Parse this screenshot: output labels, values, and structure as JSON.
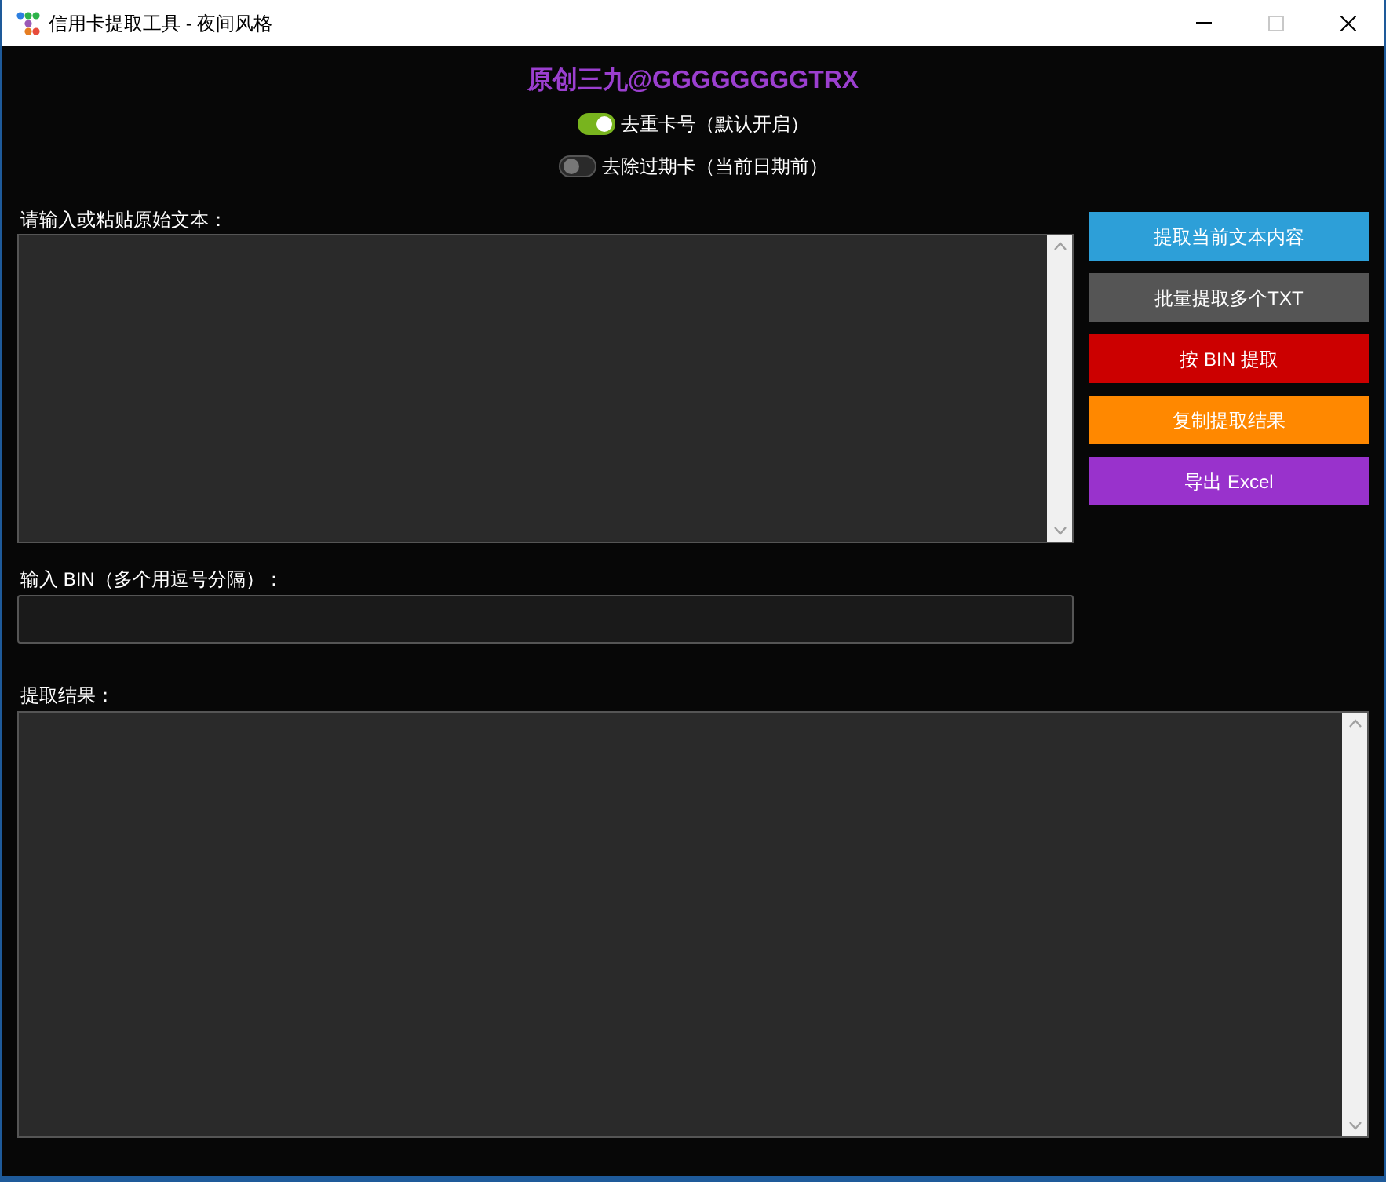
{
  "window": {
    "title": "信用卡提取工具 - 夜间风格"
  },
  "header": "原创三九@GGGGGGGGTRX",
  "toggles": [
    {
      "label": "去重卡号（默认开启）",
      "on": true
    },
    {
      "label": "去除过期卡（当前日期前）",
      "on": false
    }
  ],
  "source_label": "请输入或粘贴原始文本：",
  "bin_label": "输入 BIN（多个用逗号分隔）：",
  "result_label": "提取结果：",
  "buttons": [
    {
      "label": "提取当前文本内容",
      "color": "#2d9fd8"
    },
    {
      "label": "批量提取多个TXT",
      "color": "#555555"
    },
    {
      "label": "按 BIN 提取",
      "color": "#cc0000"
    },
    {
      "label": "复制提取结果",
      "color": "#ff8800"
    },
    {
      "label": "导出 Excel",
      "color": "#9932cc"
    }
  ]
}
